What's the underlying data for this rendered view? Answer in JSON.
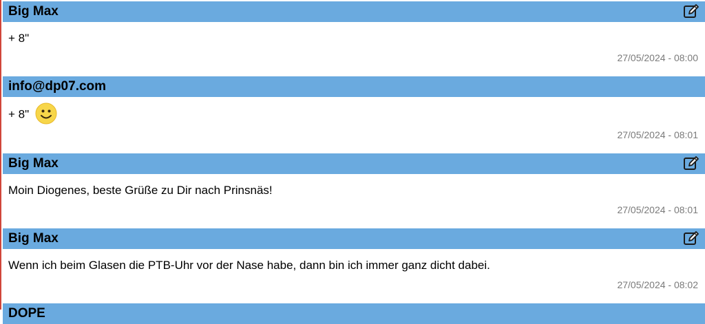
{
  "posts": [
    {
      "author": "Big Max",
      "message": "+ 8\"",
      "timestamp": "27/05/2024 - 08:00",
      "editable": true,
      "emoji": ""
    },
    {
      "author": "info@dp07.com",
      "message": "+ 8\"",
      "timestamp": "27/05/2024 - 08:01",
      "editable": false,
      "emoji": "smiley-icon"
    },
    {
      "author": "Big Max",
      "message": "Moin Diogenes, beste Grüße zu Dir nach Prinsnäs!",
      "timestamp": "27/05/2024 - 08:01",
      "editable": true,
      "emoji": ""
    },
    {
      "author": "Big Max",
      "message": "Wenn ich beim Glasen die PTB-Uhr vor der Nase habe, dann bin ich immer ganz dicht dabei.",
      "timestamp": "27/05/2024 - 08:02",
      "editable": true,
      "emoji": ""
    },
    {
      "author": "DOPE",
      "message": "",
      "timestamp": "",
      "editable": false,
      "emoji": ""
    }
  ],
  "icons": {
    "edit": "edit-icon",
    "smiley": "smiley-icon"
  },
  "colors": {
    "header_bg": "#6aaadf",
    "timestamp": "#7a7a7a",
    "left_border": "#d0453a"
  }
}
